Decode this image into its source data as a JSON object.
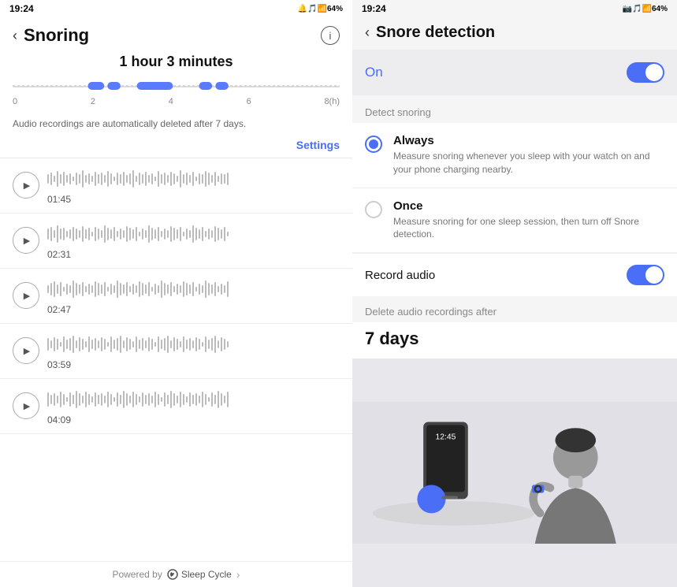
{
  "left": {
    "status_bar": {
      "time": "19:24",
      "icons": "🔔🎵📶64%"
    },
    "title": "Snoring",
    "duration": "1 hour 3 minutes",
    "timeline": {
      "labels": [
        "0",
        "2",
        "4",
        "6",
        "8(h)"
      ],
      "segments": [
        {
          "left_pct": 26,
          "width_pct": 6
        },
        {
          "left_pct": 35,
          "width_pct": 12
        },
        {
          "left_pct": 55,
          "width_pct": 10
        }
      ]
    },
    "audio_note": "Audio recordings are automatically deleted after 7 days.",
    "settings_link": "Settings",
    "recordings": [
      {
        "time": "01:45"
      },
      {
        "time": "02:31"
      },
      {
        "time": "02:47"
      },
      {
        "time": "03:59"
      },
      {
        "time": "04:09"
      }
    ],
    "powered_by": "Powered by",
    "sleep_cycle": "Sleep Cycle"
  },
  "right": {
    "status_bar": {
      "time": "19:24",
      "icons": "📷🎵📶64%"
    },
    "title": "Snore detection",
    "toggle": {
      "label": "On",
      "state": true
    },
    "detect_snoring_label": "Detect snoring",
    "options": [
      {
        "label": "Always",
        "description": "Measure snoring whenever you sleep with your watch on and your phone charging nearby.",
        "selected": true
      },
      {
        "label": "Once",
        "description": "Measure snoring for one sleep session, then turn off Snore detection.",
        "selected": false
      }
    ],
    "record_audio": {
      "label": "Record audio",
      "state": true
    },
    "delete_label": "Delete audio recordings after",
    "delete_days": "7 days",
    "illustration": {
      "phone_time": "12:45"
    }
  }
}
